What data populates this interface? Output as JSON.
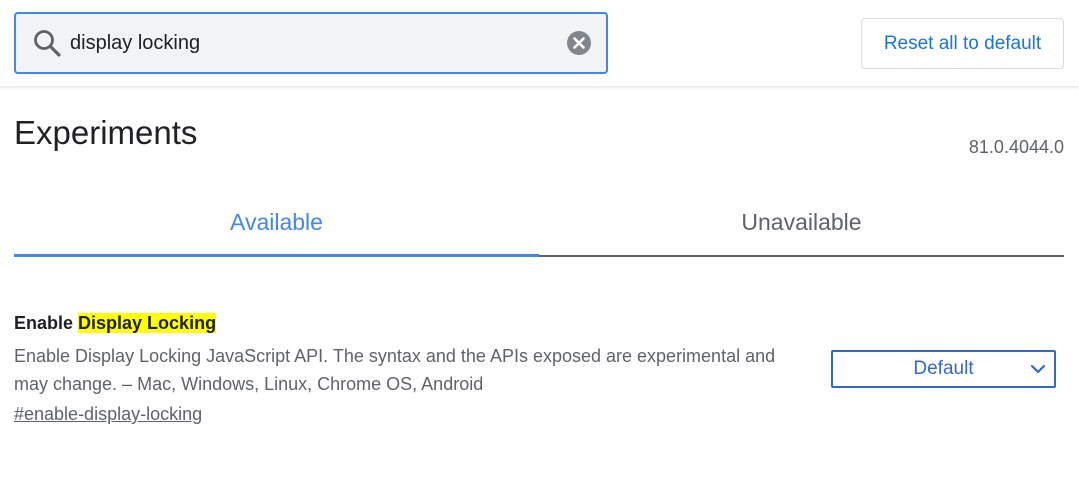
{
  "header": {
    "search": {
      "value": "display locking",
      "placeholder": "Search flags"
    },
    "reset_label": "Reset all to default"
  },
  "page": {
    "title": "Experiments",
    "version": "81.0.4044.0"
  },
  "tabs": [
    {
      "label": "Available",
      "active": true
    },
    {
      "label": "Unavailable",
      "active": false
    }
  ],
  "experiment": {
    "title_prefix": "Enable ",
    "title_highlight": "Display Locking",
    "description": "Enable Display Locking JavaScript API. The syntax and the APIs exposed are experimental and may change. – Mac, Windows, Linux, Chrome OS, Android",
    "link": "#enable-display-locking",
    "selected_option": "Default"
  },
  "colors": {
    "accent": "#4285f4",
    "link_blue": "#1a73e8",
    "select_blue": "#3367d6",
    "highlight": "#ffff00"
  },
  "icons": {
    "search": "search-icon",
    "clear": "clear-icon",
    "dropdown": "chevron-down-icon"
  }
}
